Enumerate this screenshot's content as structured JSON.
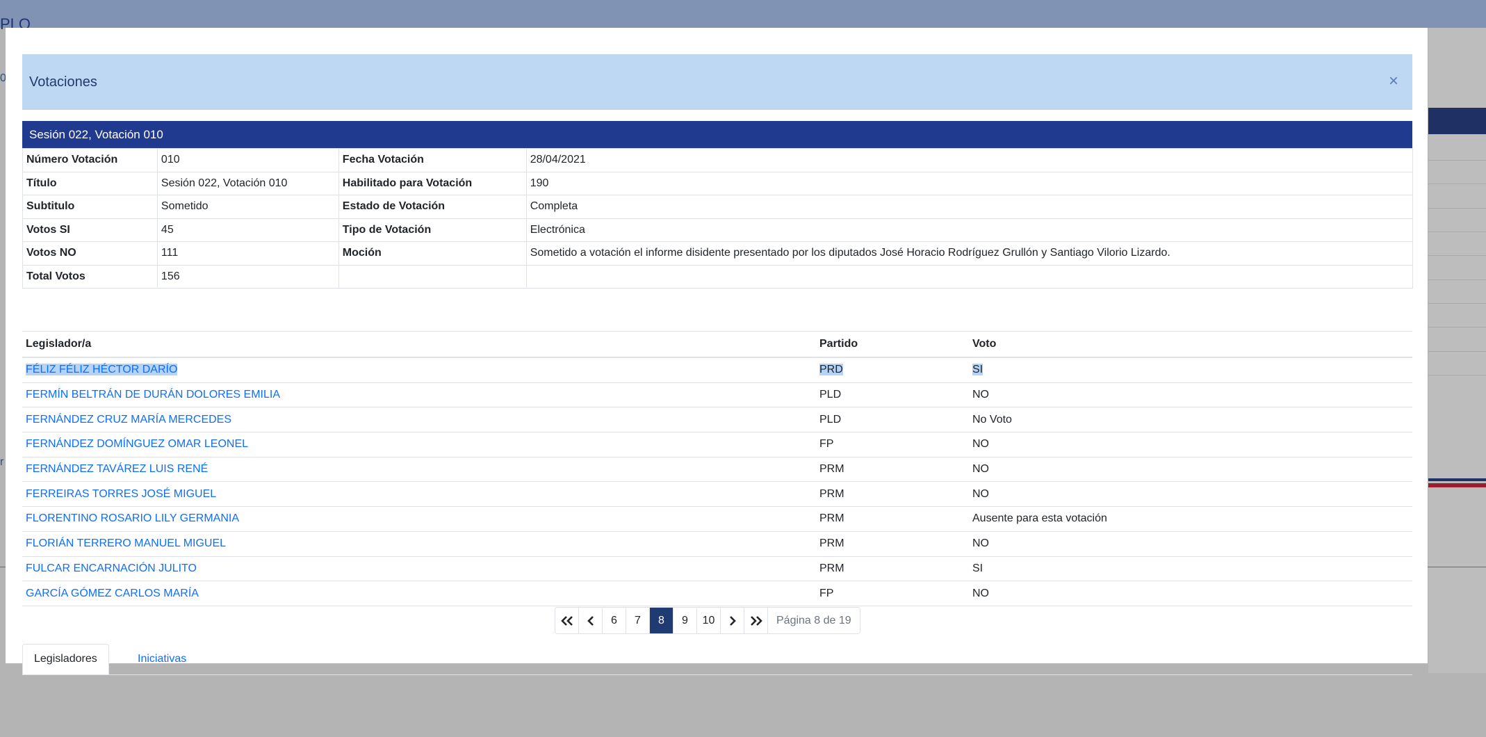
{
  "background": {
    "header_text": "PLO",
    "left_text_1": "0",
    "left_text_2": "r"
  },
  "modal": {
    "title": "Votaciones",
    "close_label": "×"
  },
  "session_header": "Sesión 022, Votación 010",
  "info": {
    "rows": [
      {
        "label1": "Número Votación",
        "value1": "010",
        "label2": "Fecha Votación",
        "value2": "28/04/2021"
      },
      {
        "label1": "Título",
        "value1": "Sesión 022, Votación 010",
        "label2": "Habilitado para Votación",
        "value2": "190"
      },
      {
        "label1": "Subtitulo",
        "value1": "Sometido",
        "label2": "Estado de Votación",
        "value2": "Completa"
      },
      {
        "label1": "Votos SI",
        "value1": "45",
        "label2": "Tipo de Votación",
        "value2": "Electrónica"
      },
      {
        "label1": "Votos NO",
        "value1": "111",
        "label2": "Moción",
        "value2": "Sometido a votación el informe disidente presentado por los diputados José Horacio Rodríguez Grullón y Santiago Vilorio Lizardo."
      },
      {
        "label1": "Total Votos",
        "value1": "156",
        "label2": "",
        "value2": ""
      }
    ]
  },
  "legislators": {
    "headers": {
      "name": "Legislador/a",
      "party": "Partido",
      "vote": "Voto"
    },
    "rows": [
      {
        "name": "FÉLIZ FÉLIZ HÉCTOR DARÍO",
        "party": "PRD",
        "vote": "SI"
      },
      {
        "name": "FERMÍN BELTRÁN DE DURÁN DOLORES EMILIA",
        "party": "PLD",
        "vote": "NO"
      },
      {
        "name": "FERNÁNDEZ CRUZ MARÍA MERCEDES",
        "party": "PLD",
        "vote": "No Voto"
      },
      {
        "name": "FERNÁNDEZ DOMÍNGUEZ OMAR LEONEL",
        "party": "FP",
        "vote": "NO"
      },
      {
        "name": "FERNÁNDEZ TAVÁREZ LUIS RENÉ",
        "party": "PRM",
        "vote": "NO"
      },
      {
        "name": "FERREIRAS TORRES JOSÉ MIGUEL",
        "party": "PRM",
        "vote": "NO"
      },
      {
        "name": "FLORENTINO ROSARIO LILY GERMANIA",
        "party": "PRM",
        "vote": "Ausente para esta votación"
      },
      {
        "name": "FLORIÁN TERRERO MANUEL MIGUEL",
        "party": "PRM",
        "vote": "NO"
      },
      {
        "name": "FULCAR ENCARNACIÓN JULITO",
        "party": "PRM",
        "vote": "SI"
      },
      {
        "name": "GARCÍA GÓMEZ CARLOS MARÍA",
        "party": "FP",
        "vote": "NO"
      }
    ]
  },
  "pagination": {
    "pages": [
      "6",
      "7",
      "8",
      "9",
      "10"
    ],
    "current": "8",
    "info": "Página 8 de 19"
  },
  "tabs": {
    "legisladores": "Legisladores",
    "iniciativas": "Iniciativas"
  }
}
